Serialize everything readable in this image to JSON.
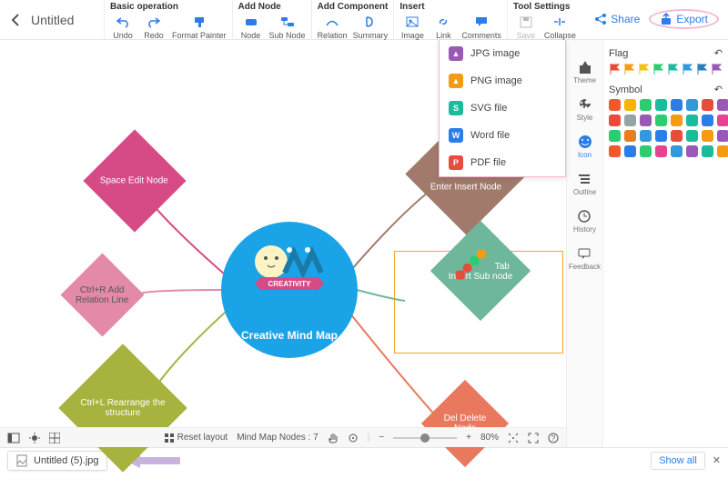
{
  "header": {
    "doc_title": "Untitled",
    "groups": {
      "basic": {
        "title": "Basic operation",
        "undo": "Undo",
        "redo": "Redo",
        "format_painter": "Format Painter"
      },
      "add_node": {
        "title": "Add Node",
        "node": "Node",
        "sub_node": "Sub Node"
      },
      "add_component": {
        "title": "Add Component",
        "relation": "Relation",
        "summary": "Summary"
      },
      "insert": {
        "title": "Insert",
        "image": "Image",
        "link": "Link",
        "comments": "Comments"
      },
      "tool_settings": {
        "title": "Tool Settings",
        "save": "Save",
        "collapse": "Collapse"
      }
    },
    "share": "Share",
    "export": "Export"
  },
  "export_menu": {
    "jpg": "JPG image",
    "png": "PNG image",
    "svg": "SVG file",
    "word": "Word file",
    "pdf": "PDF file"
  },
  "side": {
    "theme": "Theme",
    "style": "Style",
    "icon": "Icon",
    "outline": "Outline",
    "history": "History",
    "feedback": "Feedback"
  },
  "panel": {
    "flag_title": "Flag",
    "symbol_title": "Symbol"
  },
  "canvas": {
    "center": "Creative Mind Map",
    "creativity_badge": "CREATIVITY",
    "n_space": "Space Edit Node",
    "n_rel": "Ctrl+R Add Relation Line",
    "n_rearr": "Ctrl+L Rearrange the structure",
    "n_enter": "Enter Insert Node",
    "n_tab": "Tab Insert Sub node",
    "n_del": "Del Delete Node"
  },
  "footer": {
    "reset": "Reset layout",
    "nodes_label": "Mind Map Nodes :",
    "nodes_count": "7",
    "zoom_pct": "80%"
  },
  "download": {
    "filename": "Untitled (5).jpg",
    "show_all": "Show all"
  },
  "colors": {
    "blue": "#2b7de9",
    "flags": [
      "#e74c3c",
      "#f39c12",
      "#f1c40f",
      "#2ecc71",
      "#1abc9c",
      "#3498db",
      "#2980b9",
      "#9b59b6"
    ],
    "symbols": [
      "#f1592a",
      "#f7b500",
      "#2ecc71",
      "#1abc9c",
      "#2b7de9",
      "#3498db",
      "#e74c3c",
      "#9b59b6",
      "#e74c3c",
      "#95a5a6",
      "#9b59b6",
      "#2ecc71",
      "#f39c12",
      "#1abc9c",
      "#2b7de9",
      "#e84393",
      "#2ecc71",
      "#e67e22",
      "#3498db",
      "#2b7de9",
      "#e74c3c",
      "#1abc9c",
      "#f39c12",
      "#9b59b6",
      "#f1592a",
      "#2b7de9",
      "#2ecc71",
      "#e84393",
      "#3498db",
      "#9b59b6",
      "#1abc9c",
      "#f39c12"
    ],
    "export_icons": {
      "jpg": "#9b59b6",
      "png": "#f39c12",
      "svg": "#1abc9c",
      "word": "#2b7de9",
      "pdf": "#e74c3c"
    }
  }
}
